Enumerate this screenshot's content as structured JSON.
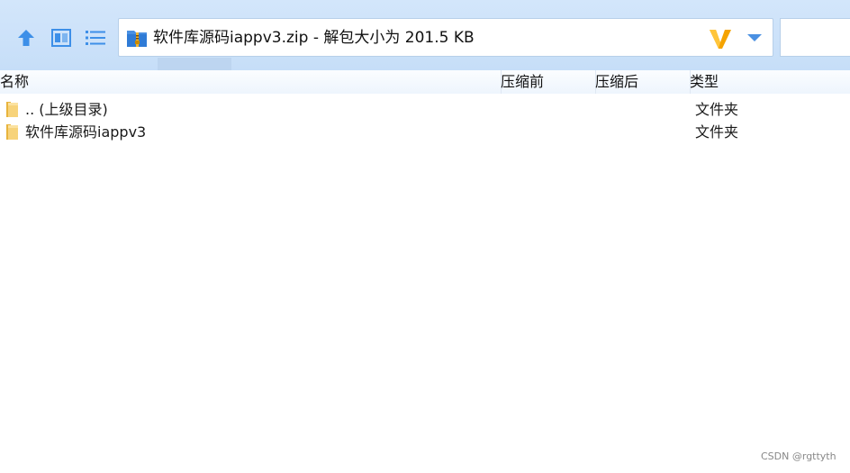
{
  "toolbar": {
    "up_icon": "arrow-up-icon",
    "thumbnail_view_icon": "thumbnail-view-icon",
    "list_view_icon": "list-view-icon",
    "accent_color": "#3d8fe8"
  },
  "address_bar": {
    "icon": "zip-archive-icon",
    "text": "软件库源码iappv3.zip - 解包大小为 201.5 KB",
    "brand_icon": "brand-v-icon",
    "dropdown_icon": "chevron-down-icon"
  },
  "columns": {
    "name": "名称",
    "compressed": "压缩前",
    "uncompressed": "压缩后",
    "type": "类型"
  },
  "rows": [
    {
      "icon": "folder-icon",
      "name": ".. (上级目录)",
      "type": "文件夹"
    },
    {
      "icon": "folder-icon",
      "name": "软件库源码iappv3",
      "type": "文件夹"
    }
  ],
  "watermark": "CSDN @rgttyth"
}
